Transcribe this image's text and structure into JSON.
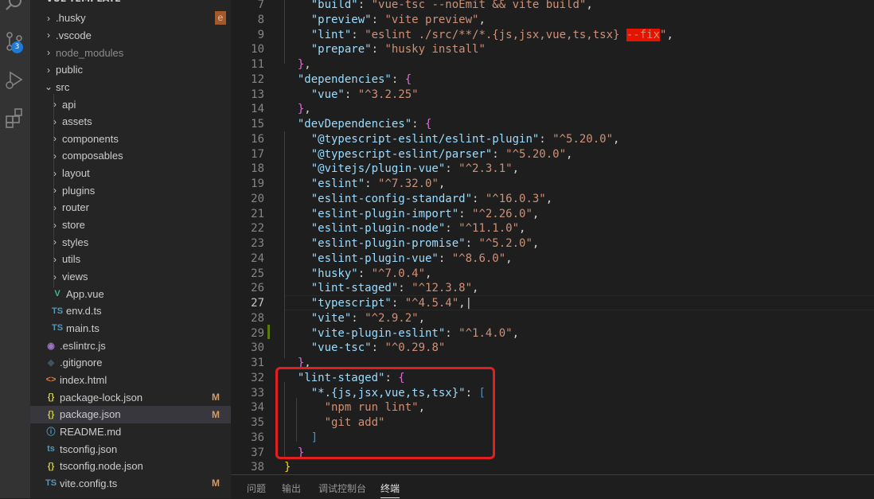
{
  "explorer": {
    "title": "VUE-TEMPLATE",
    "items": [
      {
        "label": ".husky",
        "type": "folder",
        "depth": 1,
        "status": "e",
        "status_style": "box"
      },
      {
        "label": ".vscode",
        "type": "folder",
        "depth": 1
      },
      {
        "label": "node_modules",
        "type": "folder",
        "depth": 1,
        "dim": true
      },
      {
        "label": "public",
        "type": "folder",
        "depth": 1
      },
      {
        "label": "src",
        "type": "folder-open",
        "depth": 1
      },
      {
        "label": "api",
        "type": "folder",
        "depth": 2
      },
      {
        "label": "assets",
        "type": "folder",
        "depth": 2
      },
      {
        "label": "components",
        "type": "folder",
        "depth": 2
      },
      {
        "label": "composables",
        "type": "folder",
        "depth": 2
      },
      {
        "label": "layout",
        "type": "folder",
        "depth": 2
      },
      {
        "label": "plugins",
        "type": "folder",
        "depth": 2
      },
      {
        "label": "router",
        "type": "folder",
        "depth": 2
      },
      {
        "label": "store",
        "type": "folder",
        "depth": 2
      },
      {
        "label": "styles",
        "type": "folder",
        "depth": 2
      },
      {
        "label": "utils",
        "type": "folder",
        "depth": 2
      },
      {
        "label": "views",
        "type": "folder",
        "depth": 2
      },
      {
        "label": "App.vue",
        "type": "vue",
        "depth": 2
      },
      {
        "label": "env.d.ts",
        "type": "ts",
        "depth": 2
      },
      {
        "label": "main.ts",
        "type": "ts",
        "depth": 2
      },
      {
        "label": ".eslintrc.js",
        "type": "eslint",
        "depth": 1
      },
      {
        "label": ".gitignore",
        "type": "git",
        "depth": 1
      },
      {
        "label": "index.html",
        "type": "html",
        "depth": 1
      },
      {
        "label": "package-lock.json",
        "type": "json",
        "depth": 1,
        "status": "M"
      },
      {
        "label": "package.json",
        "type": "json",
        "depth": 1,
        "status": "M",
        "selected": true
      },
      {
        "label": "README.md",
        "type": "info",
        "depth": 1
      },
      {
        "label": "tsconfig.json",
        "type": "tsconfig",
        "depth": 1
      },
      {
        "label": "tsconfig.node.json",
        "type": "json",
        "depth": 1
      },
      {
        "label": "vite.config.ts",
        "type": "ts",
        "depth": 1,
        "status": "M"
      }
    ]
  },
  "activity_bar": {
    "icons": [
      "search-icon",
      "source-control-icon",
      "run-debug-icon",
      "extensions-icon"
    ],
    "source_control_badge": "3"
  },
  "editor": {
    "active_line": 27,
    "lines": [
      {
        "n": "7",
        "tokens": [
          [
            "    ",
            "p"
          ],
          [
            "\"build\"",
            "k"
          ],
          [
            ": ",
            "p"
          ],
          [
            "\"vue-tsc --noEmit && vite build\"",
            "s"
          ],
          [
            ",",
            "p"
          ]
        ]
      },
      {
        "n": "8",
        "tokens": [
          [
            "    ",
            "p"
          ],
          [
            "\"preview\"",
            "k"
          ],
          [
            ": ",
            "p"
          ],
          [
            "\"vite preview\"",
            "s"
          ],
          [
            ",",
            "p"
          ]
        ]
      },
      {
        "n": "9",
        "tokens": [
          [
            "    ",
            "p"
          ],
          [
            "\"lint\"",
            "k"
          ],
          [
            ": ",
            "p"
          ],
          [
            "\"eslint ./src/**/*.{js,jsx,vue,ts,tsx} ",
            "s"
          ],
          [
            "--fix",
            "err"
          ],
          [
            "\"",
            "s"
          ],
          [
            ",",
            "p"
          ]
        ]
      },
      {
        "n": "10",
        "tokens": [
          [
            "    ",
            "p"
          ],
          [
            "\"prepare\"",
            "k"
          ],
          [
            ": ",
            "p"
          ],
          [
            "\"husky install\"",
            "s"
          ]
        ]
      },
      {
        "n": "11",
        "tokens": [
          [
            "  ",
            "p"
          ],
          [
            "}",
            "b1"
          ],
          [
            ",",
            "p"
          ]
        ]
      },
      {
        "n": "12",
        "tokens": [
          [
            "  ",
            "p"
          ],
          [
            "\"dependencies\"",
            "k"
          ],
          [
            ": ",
            "p"
          ],
          [
            "{",
            "b1"
          ]
        ]
      },
      {
        "n": "13",
        "tokens": [
          [
            "    ",
            "p"
          ],
          [
            "\"vue\"",
            "k"
          ],
          [
            ": ",
            "p"
          ],
          [
            "\"^3.2.25\"",
            "s"
          ]
        ]
      },
      {
        "n": "14",
        "tokens": [
          [
            "  ",
            "p"
          ],
          [
            "}",
            "b1"
          ],
          [
            ",",
            "p"
          ]
        ]
      },
      {
        "n": "15",
        "tokens": [
          [
            "  ",
            "p"
          ],
          [
            "\"devDependencies\"",
            "k"
          ],
          [
            ": ",
            "p"
          ],
          [
            "{",
            "b1"
          ]
        ]
      },
      {
        "n": "16",
        "tokens": [
          [
            "    ",
            "p"
          ],
          [
            "\"@typescript-eslint/eslint-plugin\"",
            "k"
          ],
          [
            ": ",
            "p"
          ],
          [
            "\"^5.20.0\"",
            "s"
          ],
          [
            ",",
            "p"
          ]
        ]
      },
      {
        "n": "17",
        "tokens": [
          [
            "    ",
            "p"
          ],
          [
            "\"@typescript-eslint/parser\"",
            "k"
          ],
          [
            ": ",
            "p"
          ],
          [
            "\"^5.20.0\"",
            "s"
          ],
          [
            ",",
            "p"
          ]
        ]
      },
      {
        "n": "18",
        "tokens": [
          [
            "    ",
            "p"
          ],
          [
            "\"@vitejs/plugin-vue\"",
            "k"
          ],
          [
            ": ",
            "p"
          ],
          [
            "\"^2.3.1\"",
            "s"
          ],
          [
            ",",
            "p"
          ]
        ]
      },
      {
        "n": "19",
        "tokens": [
          [
            "    ",
            "p"
          ],
          [
            "\"eslint\"",
            "k"
          ],
          [
            ": ",
            "p"
          ],
          [
            "\"^7.32.0\"",
            "s"
          ],
          [
            ",",
            "p"
          ]
        ]
      },
      {
        "n": "20",
        "tokens": [
          [
            "    ",
            "p"
          ],
          [
            "\"eslint-config-standard\"",
            "k"
          ],
          [
            ": ",
            "p"
          ],
          [
            "\"^16.0.3\"",
            "s"
          ],
          [
            ",",
            "p"
          ]
        ]
      },
      {
        "n": "21",
        "tokens": [
          [
            "    ",
            "p"
          ],
          [
            "\"eslint-plugin-import\"",
            "k"
          ],
          [
            ": ",
            "p"
          ],
          [
            "\"^2.26.0\"",
            "s"
          ],
          [
            ",",
            "p"
          ]
        ]
      },
      {
        "n": "22",
        "tokens": [
          [
            "    ",
            "p"
          ],
          [
            "\"eslint-plugin-node\"",
            "k"
          ],
          [
            ": ",
            "p"
          ],
          [
            "\"^11.1.0\"",
            "s"
          ],
          [
            ",",
            "p"
          ]
        ]
      },
      {
        "n": "23",
        "tokens": [
          [
            "    ",
            "p"
          ],
          [
            "\"eslint-plugin-promise\"",
            "k"
          ],
          [
            ": ",
            "p"
          ],
          [
            "\"^5.2.0\"",
            "s"
          ],
          [
            ",",
            "p"
          ]
        ]
      },
      {
        "n": "24",
        "tokens": [
          [
            "    ",
            "p"
          ],
          [
            "\"eslint-plugin-vue\"",
            "k"
          ],
          [
            ": ",
            "p"
          ],
          [
            "\"^8.6.0\"",
            "s"
          ],
          [
            ",",
            "p"
          ]
        ]
      },
      {
        "n": "25",
        "tokens": [
          [
            "    ",
            "p"
          ],
          [
            "\"husky\"",
            "k"
          ],
          [
            ": ",
            "p"
          ],
          [
            "\"^7.0.4\"",
            "s"
          ],
          [
            ",",
            "p"
          ]
        ]
      },
      {
        "n": "26",
        "tokens": [
          [
            "    ",
            "p"
          ],
          [
            "\"lint-staged\"",
            "k"
          ],
          [
            ": ",
            "p"
          ],
          [
            "\"^12.3.8\"",
            "s"
          ],
          [
            ",",
            "p"
          ]
        ]
      },
      {
        "n": "27",
        "tokens": [
          [
            "    ",
            "p"
          ],
          [
            "\"typescript\"",
            "k"
          ],
          [
            ": ",
            "p"
          ],
          [
            "\"^4.5.4\"",
            "s"
          ],
          [
            ",|",
            "p"
          ]
        ]
      },
      {
        "n": "28",
        "tokens": [
          [
            "    ",
            "p"
          ],
          [
            "\"vite\"",
            "k"
          ],
          [
            ": ",
            "p"
          ],
          [
            "\"^2.9.2\"",
            "s"
          ],
          [
            ",",
            "p"
          ]
        ]
      },
      {
        "n": "29",
        "tokens": [
          [
            "    ",
            "p"
          ],
          [
            "\"vite-plugin-eslint\"",
            "k"
          ],
          [
            ": ",
            "p"
          ],
          [
            "\"^1.4.0\"",
            "s"
          ],
          [
            ",",
            "p"
          ]
        ]
      },
      {
        "n": "30",
        "tokens": [
          [
            "    ",
            "p"
          ],
          [
            "\"vue-tsc\"",
            "k"
          ],
          [
            ": ",
            "p"
          ],
          [
            "\"^0.29.8\"",
            "s"
          ]
        ]
      },
      {
        "n": "31",
        "tokens": [
          [
            "  ",
            "p"
          ],
          [
            "}",
            "b1"
          ],
          [
            ",",
            "p"
          ]
        ]
      },
      {
        "n": "32",
        "tokens": [
          [
            "  ",
            "p"
          ],
          [
            "\"lint-staged\"",
            "k"
          ],
          [
            ": ",
            "p"
          ],
          [
            "{",
            "b1"
          ]
        ]
      },
      {
        "n": "33",
        "tokens": [
          [
            "    ",
            "p"
          ],
          [
            "\"*.{js,jsx,vue,ts,tsx}\"",
            "k"
          ],
          [
            ": ",
            "p"
          ],
          [
            "[",
            "b2"
          ]
        ]
      },
      {
        "n": "34",
        "tokens": [
          [
            "      ",
            "p"
          ],
          [
            "\"npm run lint\"",
            "s"
          ],
          [
            ",",
            "p"
          ]
        ]
      },
      {
        "n": "35",
        "tokens": [
          [
            "      ",
            "p"
          ],
          [
            "\"git add\"",
            "s"
          ]
        ]
      },
      {
        "n": "36",
        "tokens": [
          [
            "    ",
            "p"
          ],
          [
            "]",
            "b2"
          ]
        ]
      },
      {
        "n": "37",
        "tokens": [
          [
            "  ",
            "p"
          ],
          [
            "}",
            "b1"
          ]
        ]
      },
      {
        "n": "38",
        "tokens": [
          [
            "",
            "p"
          ],
          [
            "}",
            "b0"
          ]
        ]
      }
    ]
  },
  "panel": {
    "tabs": [
      {
        "label": "问题",
        "active": false
      },
      {
        "label": "输出",
        "active": false
      },
      {
        "label": "调试控制台",
        "active": false
      },
      {
        "label": "终端",
        "active": true
      }
    ]
  },
  "colors": {
    "highlight_box": "#e02020",
    "modified_status": "#d19a66",
    "error_highlight": "#e51400"
  }
}
